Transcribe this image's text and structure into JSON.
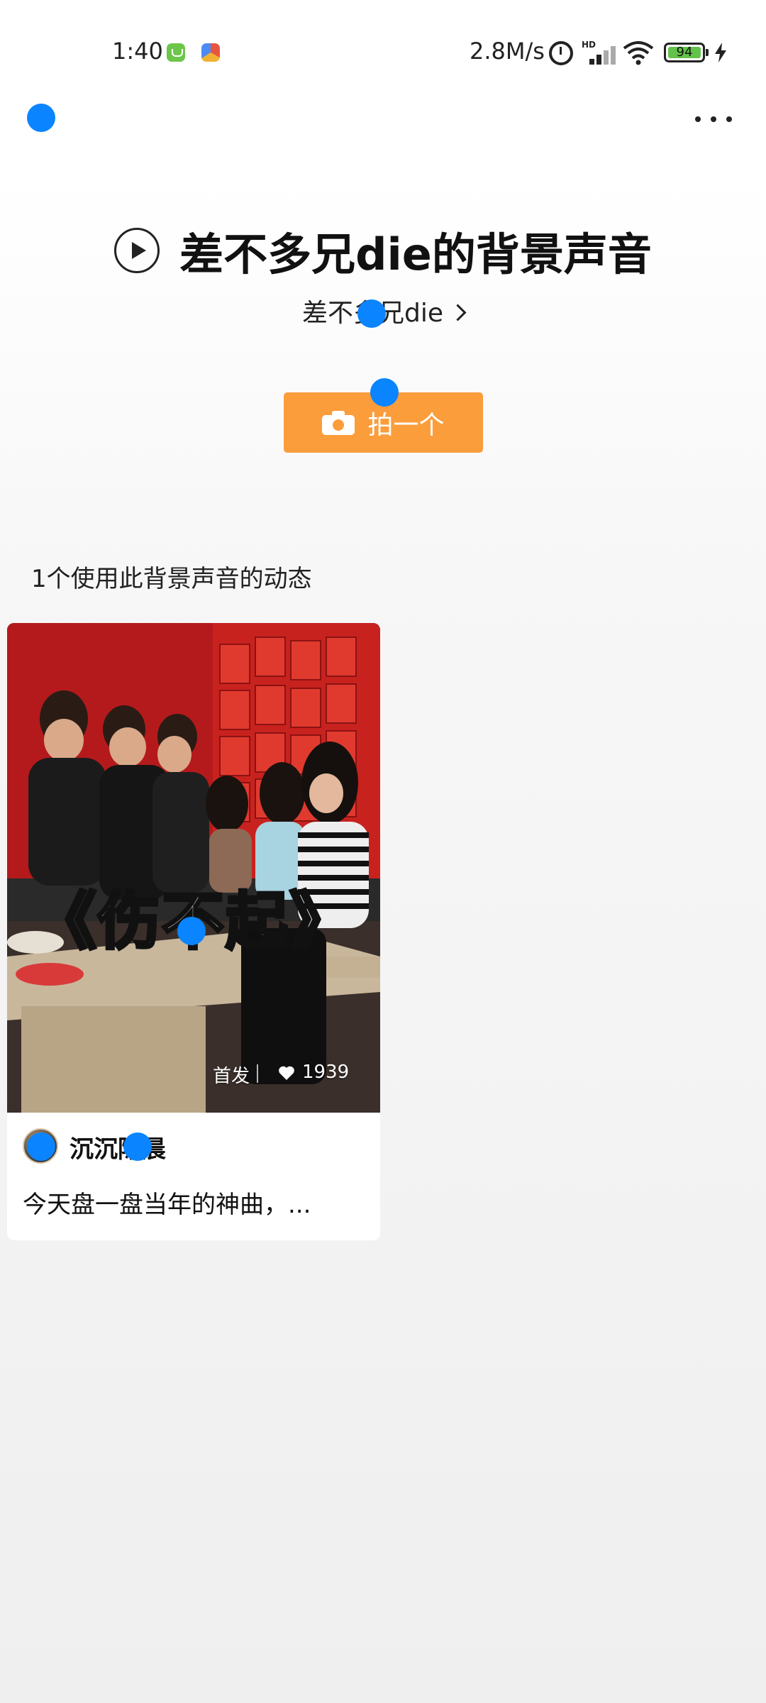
{
  "status_bar": {
    "time": "1:40",
    "network_speed": "2.8M/s",
    "network_type": "HD",
    "battery_level": "94",
    "icons": [
      "app-notification-icon",
      "app-notification-icon",
      "alarm-icon",
      "signal-icon",
      "wifi-icon",
      "battery-icon",
      "charging-icon"
    ]
  },
  "header": {
    "back_icon": "back-icon",
    "more_icon": "more-icon"
  },
  "sound": {
    "title": "差不多兄die的背景声音",
    "author": "差不多兄die",
    "play_icon": "play-icon"
  },
  "actions": {
    "shoot_label": "拍一个",
    "shoot_icon": "camera-icon",
    "accent_color": "#fb9d3b"
  },
  "posts_section": {
    "label": "1个使用此背景声音的动态"
  },
  "posts": [
    {
      "cover_caption": "《伤不起》",
      "badge": "首发",
      "likes": "1939",
      "author": "沉沉陈晨",
      "description": "今天盘一盘当年的神曲，..."
    }
  ],
  "colors": {
    "accent_blue_marker": "#0a84ff",
    "background_top": "#ffffff",
    "background_bottom": "#efefef"
  }
}
